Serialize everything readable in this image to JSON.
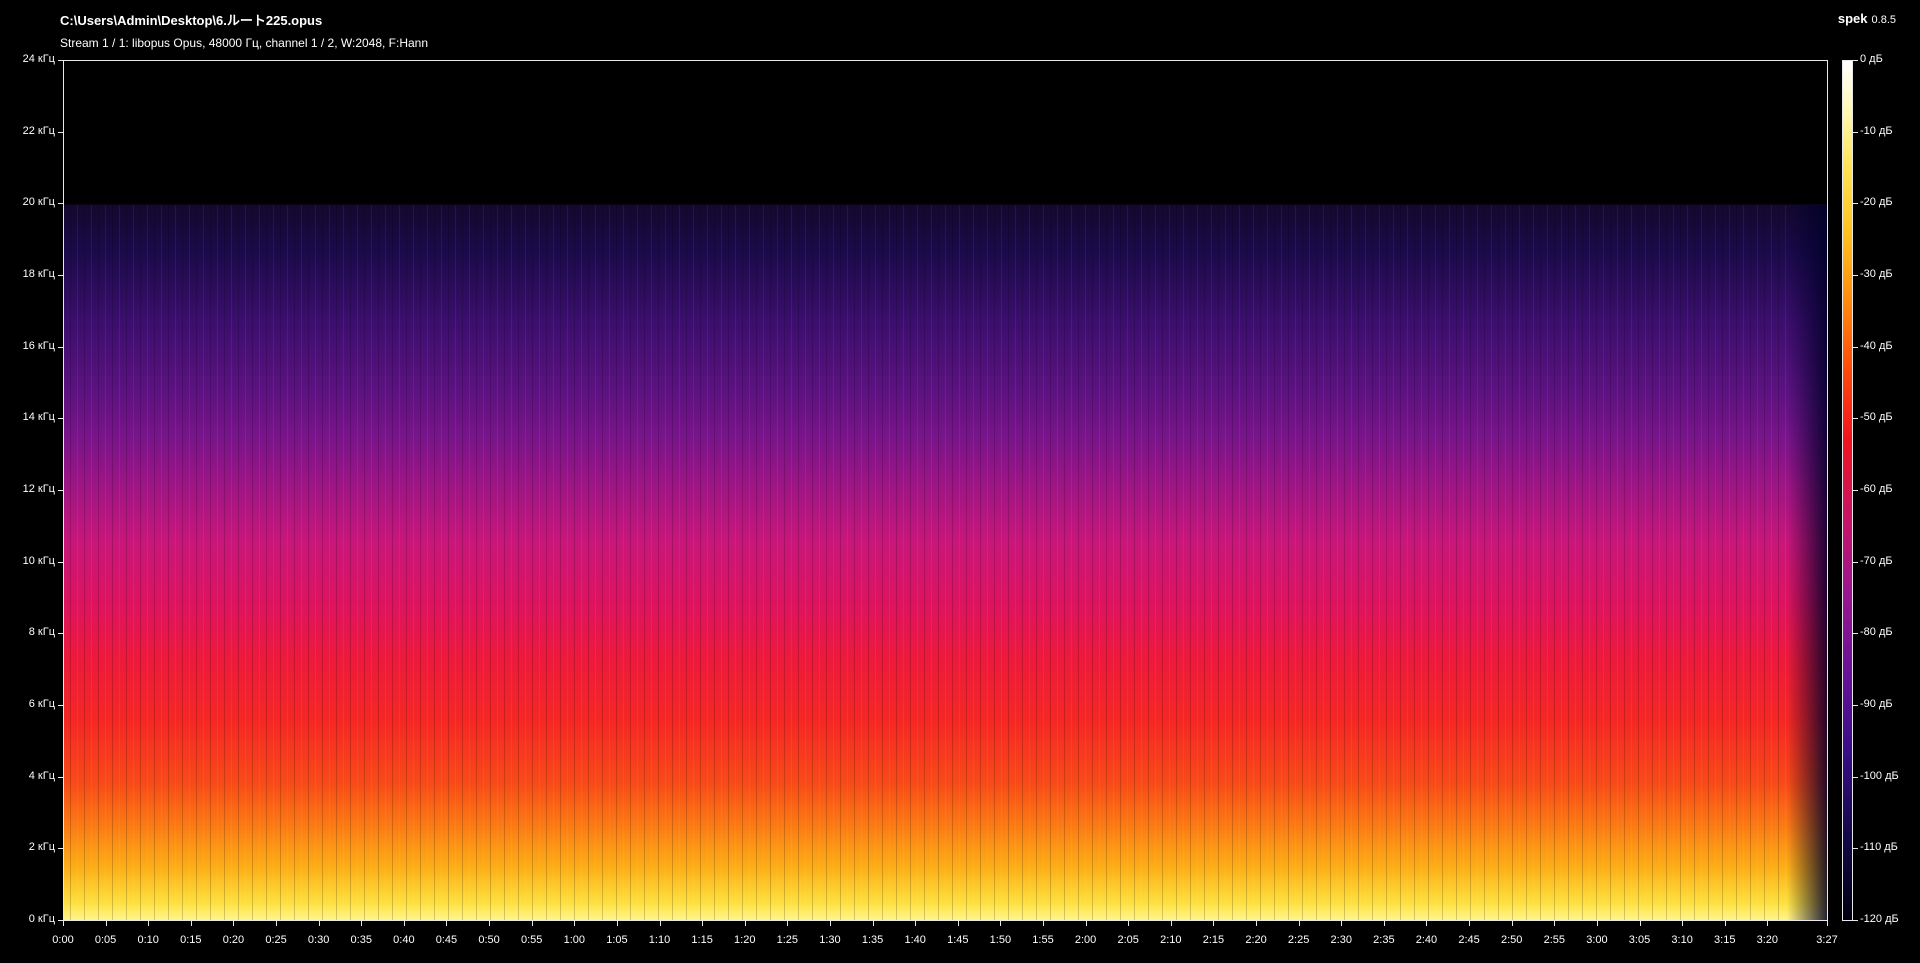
{
  "header": {
    "title": "C:\\Users\\Admin\\Desktop\\6.ルート225.opus",
    "subtitle": "Stream 1 / 1: libopus Opus, 48000 Гц, channel 1 / 2, W:2048, F:Hann",
    "brand": "spek",
    "version": "0.8.5"
  },
  "y_axis": {
    "labels": [
      "24 кГц",
      "22 кГц",
      "20 кГц",
      "18 кГц",
      "16 кГц",
      "14 кГц",
      "12 кГц",
      "10 кГц",
      "8 кГц",
      "6 кГц",
      "4 кГц",
      "2 кГц",
      "0 кГц"
    ],
    "range": [
      0,
      24
    ],
    "unit": "кГц"
  },
  "x_axis": {
    "labels": [
      "0:00",
      "0:05",
      "0:10",
      "0:15",
      "0:20",
      "0:25",
      "0:30",
      "0:35",
      "0:40",
      "0:45",
      "0:50",
      "0:55",
      "1:00",
      "1:05",
      "1:10",
      "1:15",
      "1:20",
      "1:25",
      "1:30",
      "1:35",
      "1:40",
      "1:45",
      "1:50",
      "1:55",
      "2:00",
      "2:05",
      "2:10",
      "2:15",
      "2:20",
      "2:25",
      "2:30",
      "2:35",
      "2:40",
      "2:45",
      "2:50",
      "2:55",
      "3:00",
      "3:05",
      "3:10",
      "3:15",
      "3:20",
      "3:27"
    ],
    "seconds": [
      0,
      5,
      10,
      15,
      20,
      25,
      30,
      35,
      40,
      45,
      50,
      55,
      60,
      65,
      70,
      75,
      80,
      85,
      90,
      95,
      100,
      105,
      110,
      115,
      120,
      125,
      130,
      135,
      140,
      145,
      150,
      155,
      160,
      165,
      170,
      175,
      180,
      185,
      190,
      195,
      200,
      207
    ],
    "duration_seconds": 207
  },
  "colorbar": {
    "labels": [
      "0 дБ",
      "-10 дБ",
      "-20 дБ",
      "-30 дБ",
      "-40 дБ",
      "-50 дБ",
      "-60 дБ",
      "-70 дБ",
      "-80 дБ",
      "-90 дБ",
      "-100 дБ",
      "-110 дБ",
      "-120 дБ"
    ]
  },
  "spectrogram": {
    "lowpass_cutoff_khz": 20,
    "colors": {
      "high": "#fff58a",
      "mid": "#ee1a3a",
      "low": "#3a0e6c",
      "background": "#000000"
    }
  }
}
